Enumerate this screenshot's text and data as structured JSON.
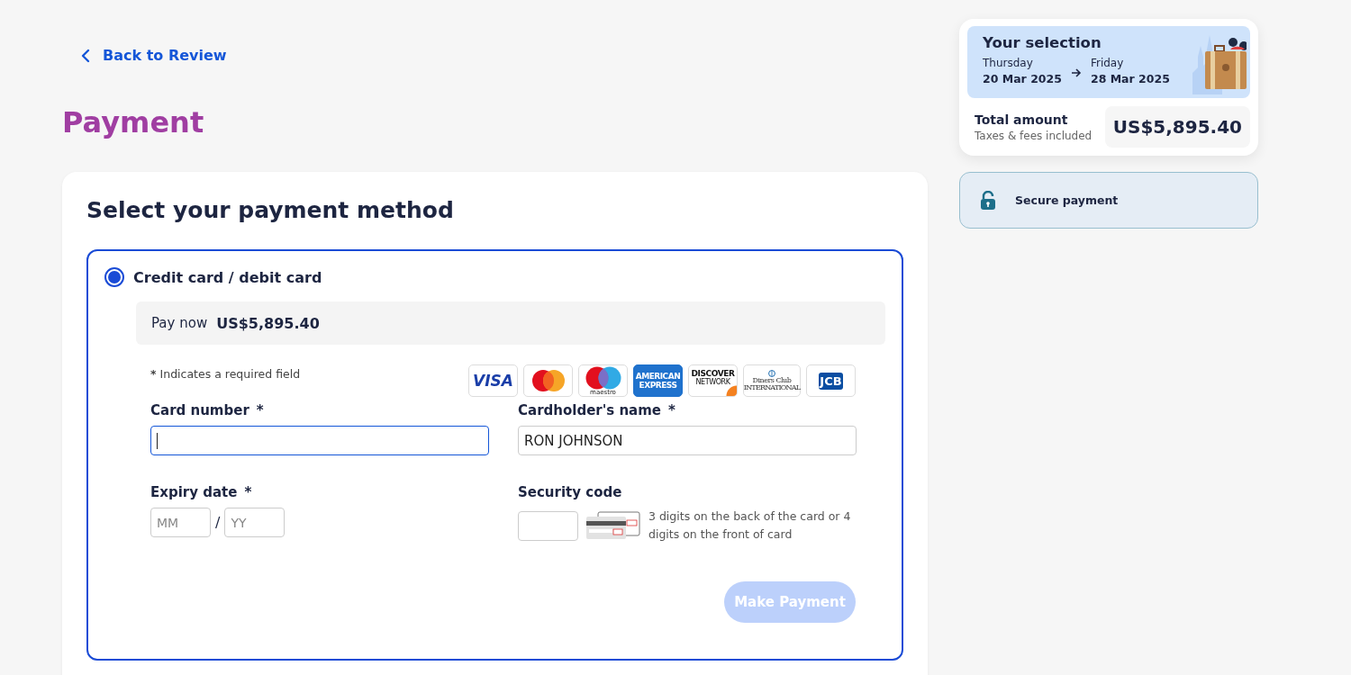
{
  "back_link": {
    "label": "Back to Review"
  },
  "page_title": "Payment",
  "payment_panel": {
    "heading": "Select your payment method",
    "methods": [
      {
        "label": "Credit card / debit card",
        "selected": true
      }
    ],
    "pay_now": {
      "label": "Pay now",
      "amount": "US$5,895.40"
    },
    "required_note": {
      "mark": "*",
      "text": "Indicates a required field"
    },
    "cards": [
      {
        "kind": "visa",
        "label": "VISA"
      },
      {
        "kind": "mastercard"
      },
      {
        "kind": "maestro",
        "label": "maestro"
      },
      {
        "kind": "amex",
        "label": "AMERICAN EXPRESS"
      },
      {
        "kind": "discover",
        "label": "DISCOVER",
        "sub": "NETWORK"
      },
      {
        "kind": "diners",
        "label": "Diners Club",
        "sub": "INTERNATIONAL"
      },
      {
        "kind": "jcb",
        "label": "JCB"
      }
    ],
    "card_number": {
      "label": "Card number",
      "required_mark": "*",
      "focused": true
    },
    "cardholder": {
      "label": "Cardholder's name",
      "required_mark": "*",
      "value": "RON JOHNSON",
      "focused": false
    },
    "expiry": {
      "label": "Expiry date",
      "required_mark": "*",
      "month_placeholder": "MM",
      "separator": "/",
      "year_placeholder": "YY"
    },
    "security_code": {
      "label": "Security code",
      "hint": "3 digits on the back of the card or 4 digits on the front of card"
    },
    "make_payment": {
      "label": "Make Payment",
      "disabled": true
    }
  },
  "summary": {
    "title": "Your selection",
    "from": {
      "day": "Thursday",
      "date": "20 Mar 2025"
    },
    "to": {
      "day": "Friday",
      "date": "28 Mar 2025"
    },
    "total_label": "Total amount",
    "total_note": "Taxes & fees included",
    "total": "US$5,895.40"
  },
  "secure_badge": {
    "label": "Secure payment"
  }
}
